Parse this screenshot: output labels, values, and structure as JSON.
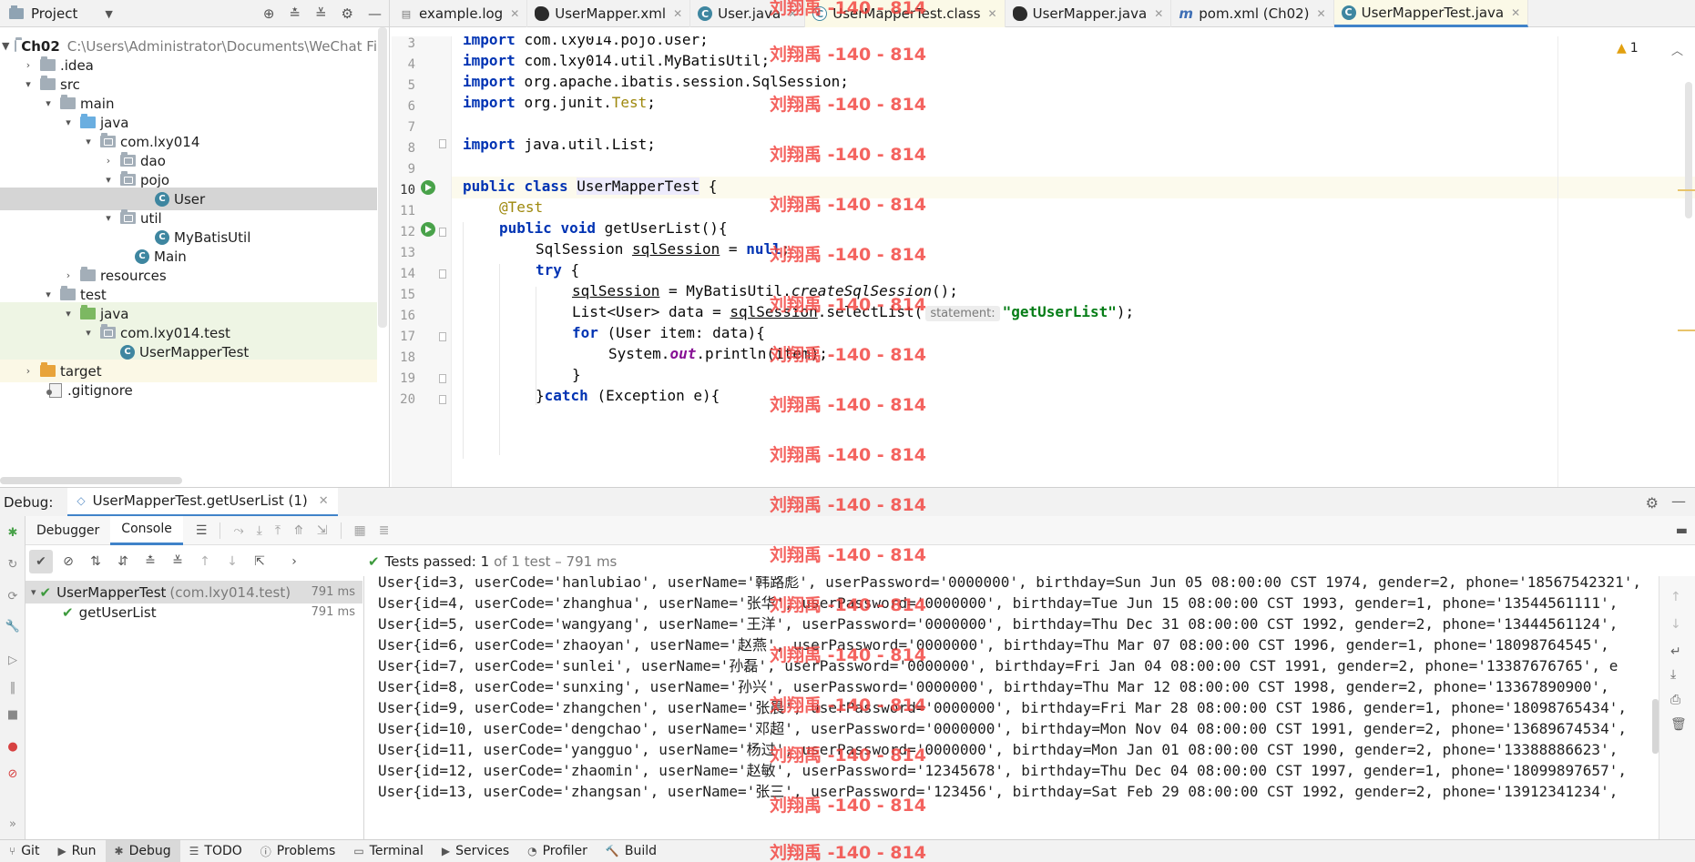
{
  "project_panel": {
    "title": "Project",
    "items": [
      {
        "label": "Ch02",
        "path": "C:\\Users\\Administrator\\Documents\\WeChat Fi"
      },
      {
        "label": ".idea"
      },
      {
        "label": "src"
      },
      {
        "label": "main"
      },
      {
        "label": "java"
      },
      {
        "label": "com.lxy014"
      },
      {
        "label": "dao"
      },
      {
        "label": "pojo"
      },
      {
        "label": "User"
      },
      {
        "label": "util"
      },
      {
        "label": "MyBatisUtil"
      },
      {
        "label": "Main"
      },
      {
        "label": "resources"
      },
      {
        "label": "test"
      },
      {
        "label": "java"
      },
      {
        "label": "com.lxy014.test"
      },
      {
        "label": "UserMapperTest"
      },
      {
        "label": "target"
      },
      {
        "label": ".gitignore"
      }
    ]
  },
  "editor_tabs": [
    {
      "label": "example.log"
    },
    {
      "label": "UserMapper.xml"
    },
    {
      "label": "User.java"
    },
    {
      "label": "UserMapperTest.class"
    },
    {
      "label": "UserMapper.java"
    },
    {
      "label": "pom.xml (Ch02)"
    },
    {
      "label": "UserMapperTest.java"
    }
  ],
  "editor": {
    "warning_count": "1",
    "line_numbers": [
      "3",
      "4",
      "5",
      "6",
      "7",
      "8",
      "9",
      "10",
      "11",
      "12",
      "13",
      "14",
      "15",
      "16",
      "17",
      "18",
      "19",
      "20"
    ],
    "code": {
      "l3": "com.lxy014.pojo.User;",
      "l4": "com.lxy014.util.MyBatisUtil;",
      "l5": "org.apache.ibatis.session.SqlSession;",
      "l6a": "org.junit.",
      "l6b": "Test",
      "l8": "java.util.List;",
      "kw_import": "import",
      "kw_public": "public",
      "kw_class": "class",
      "class_name": "UserMapperTest",
      "brace_open": " {",
      "annotation": "@Test",
      "kw_void": "void",
      "method_sig": "getUserList(){",
      "l13_type": "SqlSession ",
      "l13_var": "sqlSession",
      "l13_eq": " = ",
      "kw_null": "null",
      "semicolon": ";",
      "kw_try": "try",
      "l15_var": "sqlSession",
      "l15_mid": " = MyBatisUtil.",
      "l15_call": "createSqlSession",
      "l15_end": "();",
      "l16_a": "List<User> data = ",
      "l16_var": "sqlSession",
      "l16_b": ".selectList(",
      "l16_hint": "statement:",
      "l16_str": "\"getUserList\"",
      "l16_end": ");",
      "kw_for": "for",
      "l17_rest": " (User item: data){",
      "l18_a": "System.",
      "l18_out": "out",
      "l18_b": ".println(item);",
      "close_brace": "}",
      "l20_a": "}",
      "kw_catch": "catch",
      "l20_b": " (Exception e){"
    }
  },
  "debug": {
    "label": "Debug:",
    "session_tab": "UserMapperTest.getUserList (1)",
    "tabs": [
      "Debugger",
      "Console"
    ],
    "tests_passed": "Tests passed: 1",
    "tests_detail": "of 1 test – 791 ms",
    "test_tree": [
      {
        "name": "UserMapperTest",
        "pkg": "(com.lxy014.test)",
        "time": "791 ms"
      },
      {
        "name": "getUserList",
        "time": "791 ms"
      }
    ],
    "console_lines": [
      "User{id=3, userCode='hanlubiao', userName='韩路彪', userPassword='0000000', birthday=Sun Jun 05 08:00:00 CST 1974, gender=2, phone='18567542321', ",
      "User{id=4, userCode='zhanghua', userName='张华', userPassword='0000000', birthday=Tue Jun 15 08:00:00 CST 1993, gender=1, phone='13544561111', ",
      "User{id=5, userCode='wangyang', userName='王洋', userPassword='0000000', birthday=Thu Dec 31 08:00:00 CST 1992, gender=2, phone='13444561124', ",
      "User{id=6, userCode='zhaoyan', userName='赵燕', userPassword='0000000', birthday=Thu Mar 07 08:00:00 CST 1996, gender=1, phone='18098764545', ",
      "User{id=7, userCode='sunlei', userName='孙磊', userPassword='0000000', birthday=Fri Jan 04 08:00:00 CST 1991, gender=2, phone='13387676765', e",
      "User{id=8, userCode='sunxing', userName='孙兴', userPassword='0000000', birthday=Thu Mar 12 08:00:00 CST 1998, gender=2, phone='13367890900', ",
      "User{id=9, userCode='zhangchen', userName='张晨', userPassword='0000000', birthday=Fri Mar 28 08:00:00 CST 1986, gender=1, phone='18098765434',",
      "User{id=10, userCode='dengchao', userName='邓超', userPassword='0000000', birthday=Mon Nov 04 08:00:00 CST 1991, gender=2, phone='13689674534',",
      "User{id=11, userCode='yangguo', userName='杨过', userPassword='0000000', birthday=Mon Jan 01 08:00:00 CST 1990, gender=2, phone='13388886623', ",
      "User{id=12, userCode='zhaomin', userName='赵敏', userPassword='12345678', birthday=Thu Dec 04 08:00:00 CST 1997, gender=1, phone='18099897657',",
      "User{id=13, userCode='zhangsan', userName='张三', userPassword='123456', birthday=Sat Feb 29 08:00:00 CST 1992, gender=2, phone='13912341234', "
    ]
  },
  "bottom_bar": [
    "Git",
    "Run",
    "Debug",
    "TODO",
    "Problems",
    "Terminal",
    "Services",
    "Profiler",
    "Build"
  ],
  "watermark": "刘翔禹 -140 - 814",
  "colors": {
    "accent": "#4083c9",
    "watermark": "#f2413c",
    "pass": "#3d9a3d"
  }
}
